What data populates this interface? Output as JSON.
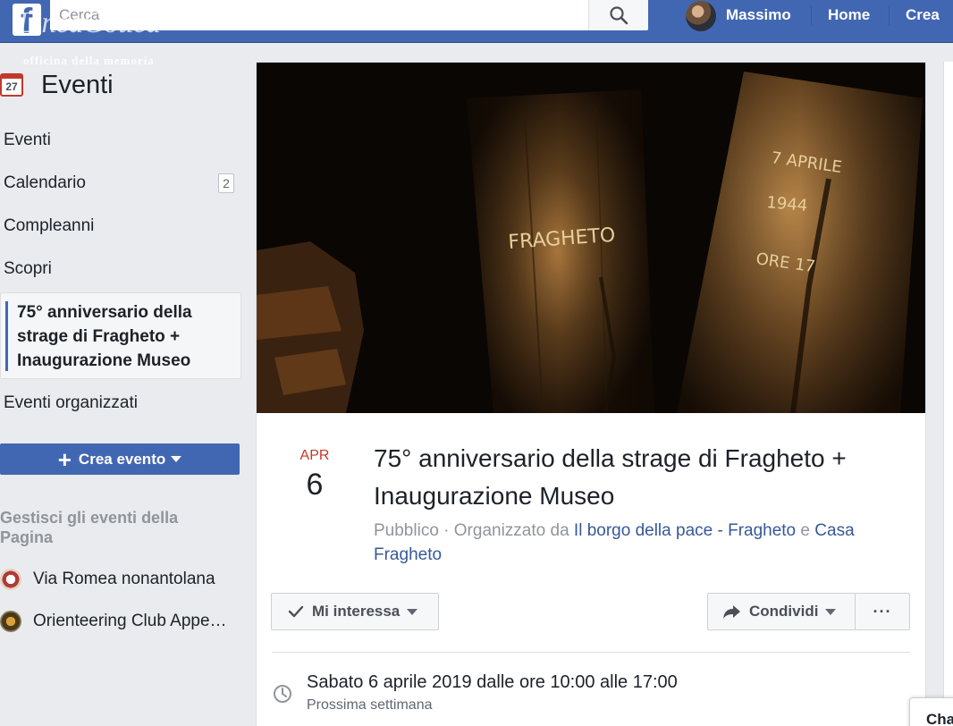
{
  "topbar": {
    "logo": "f",
    "search_placeholder": "Cerca",
    "user_name": "Massimo",
    "nav_home": "Home",
    "nav_create": "Crea"
  },
  "watermark": {
    "title": "LineaGotica",
    "subtitle": "officina della memoria"
  },
  "sidebar": {
    "header_icon_day": "27",
    "header_title": "Eventi",
    "items": [
      {
        "label": "Eventi"
      },
      {
        "label": "Calendario",
        "count": "2"
      },
      {
        "label": "Compleanni"
      },
      {
        "label": "Scopri"
      },
      {
        "label": "75° anniversario della strage di Fragheto + Inaugurazione Museo"
      },
      {
        "label": "Eventi organizzati"
      }
    ],
    "create_button": "Crea evento",
    "manage_heading": "Gestisci gli eventi della Pagina",
    "pages": [
      {
        "label": "Via Romea nonantolana"
      },
      {
        "label": "Orienteering Club Appe…"
      }
    ]
  },
  "event": {
    "cover_text_1": "FRAGHETO",
    "cover_text_2": "7 APRILE",
    "cover_text_3": "1944",
    "cover_text_4": "ORE 17",
    "month": "APR",
    "day": "6",
    "title": "75° anniversario della strage di Fragheto + Inaugurazione Museo",
    "privacy": "Pubblico",
    "organized_by": "· Organizzato da",
    "organizer_1": "Il borgo della pace - Fragheto",
    "conjunction": "e",
    "organizer_2": "Casa Fragheto",
    "interested_button": "Mi interessa",
    "share_button": "Condividi",
    "more_button": "···",
    "when": "Sabato 6 aprile 2019 dalle ore 10:00 alle 17:00",
    "when_sub": "Prossima settimana"
  },
  "chat": {
    "label": "Chat"
  },
  "colors": {
    "brand_blue": "#4267b2",
    "link_blue": "#385898",
    "month_red": "#c0392b"
  }
}
